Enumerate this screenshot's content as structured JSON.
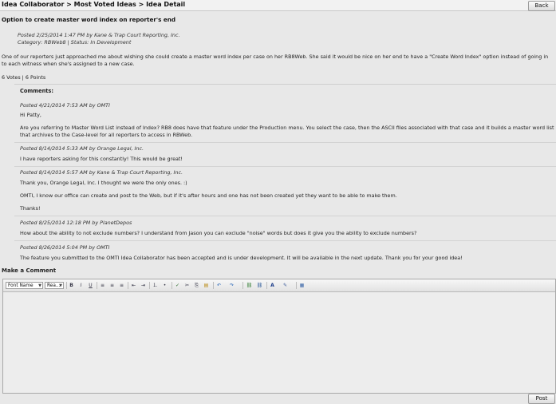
{
  "header": {
    "breadcrumb": "Idea Collaborator > Most Voted Ideas > Idea Detail",
    "back_label": "Back"
  },
  "idea": {
    "title": "Option to create master word index on reporter's end",
    "posted": "Posted 2/25/2014 1:47 PM by Kane & Trap Court Reporting, Inc.",
    "category_line": "Category: RBWeb8   |   Status: In Development",
    "description": "One of our reporters just approached me about wishing she could create a master word index per case on her RB8Web.  She said it would be nice on her end to have a \"Create Word Index\" option instead of going in to each witness when she's assigned to a new case.",
    "votes_line": "6 Votes   |   6 Points"
  },
  "comments": {
    "heading": "Comments:",
    "items": [
      {
        "header": "Posted 4/21/2014 7:53 AM by OMTI",
        "lines": [
          "Hi Patty,",
          "Are you referring to Master Word List instead of Index?  RB8 does have that feature under the Production menu.  You select the case, then the ASCII files associated with that case and it builds a master word list that archives to the Case-level for all reporters to access in RBWeb."
        ]
      },
      {
        "header": "Posted 8/14/2014 5:33 AM by Orange Legal, Inc.",
        "lines": [
          "I have reporters asking for this constantly! This would be great!"
        ]
      },
      {
        "header": "Posted 8/14/2014 5:57 AM by Kane & Trap Court Reporting, Inc.",
        "lines": [
          "Thank you, Orange Legal, Inc.  I thought we were the only ones.  :)",
          "OMTI, I know our office can create and post to the Web, but if it's after hours and one has not been created yet they want to be able to make them.",
          "Thanks!"
        ]
      },
      {
        "header": "Posted 8/25/2014 12:18 PM by PlanetDepos",
        "lines": [
          "How about the ability to not exclude numbers?  I understand from Jason you can exclude \"noise\" words but does it give you the ability to exclude numbers?"
        ]
      },
      {
        "header": "Posted 8/26/2014 5:04 PM by OMTI",
        "lines": [
          "The feature you submitted to the OMTI Idea Collaborator has been accepted and is under development. It will be available in the next update. Thank you for your good idea!"
        ]
      }
    ]
  },
  "make_comment": {
    "heading": "Make a Comment",
    "font_name": "Font Name",
    "font_size": "Rea...",
    "post_label": "Post",
    "toolbar_buttons": [
      {
        "name": "bold-icon",
        "glyph": "B"
      },
      {
        "name": "italic-icon",
        "glyph": "I"
      },
      {
        "name": "underline-icon",
        "glyph": "U"
      },
      {
        "name": "align-left-icon",
        "glyph": "≡"
      },
      {
        "name": "align-center-icon",
        "glyph": "≡"
      },
      {
        "name": "align-right-icon",
        "glyph": "≡"
      },
      {
        "name": "outdent-icon",
        "glyph": "⇤"
      },
      {
        "name": "indent-icon",
        "glyph": "⇥"
      },
      {
        "name": "ordered-list-icon",
        "glyph": "⒈"
      },
      {
        "name": "bullet-list-icon",
        "glyph": "•"
      },
      {
        "name": "spellcheck-icon",
        "glyph": "✓"
      },
      {
        "name": "cut-icon",
        "glyph": "✂"
      },
      {
        "name": "copy-icon",
        "glyph": "⎘"
      },
      {
        "name": "paste-icon",
        "glyph": "▤"
      },
      {
        "name": "undo-icon",
        "glyph": "↶"
      },
      {
        "name": "redo-icon",
        "glyph": "↷"
      },
      {
        "name": "insert-link-icon",
        "glyph": "⛓"
      },
      {
        "name": "remove-link-icon",
        "glyph": "⛓"
      },
      {
        "name": "font-color-icon",
        "glyph": "A"
      },
      {
        "name": "highlight-icon",
        "glyph": "✎"
      },
      {
        "name": "insert-image-icon",
        "glyph": "▦"
      }
    ]
  }
}
